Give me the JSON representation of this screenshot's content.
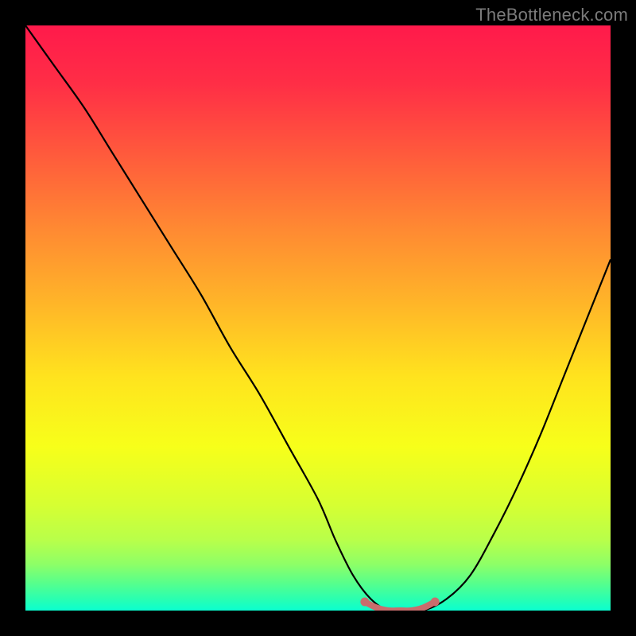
{
  "watermark": "TheBottleneck.com",
  "chart_data": {
    "type": "line",
    "title": "",
    "xlabel": "",
    "ylabel": "",
    "xlim": [
      0,
      100
    ],
    "ylim": [
      0,
      100
    ],
    "legend": false,
    "grid": false,
    "series": [
      {
        "name": "bottleneck-curve",
        "x": [
          0,
          5,
          10,
          15,
          20,
          25,
          30,
          35,
          40,
          45,
          50,
          53,
          56,
          59,
          62,
          65,
          68,
          72,
          76,
          80,
          84,
          88,
          92,
          96,
          100
        ],
        "y": [
          100,
          93,
          86,
          78,
          70,
          62,
          54,
          45,
          37,
          28,
          19,
          12,
          6,
          2,
          0,
          0,
          0,
          2,
          6,
          13,
          21,
          30,
          40,
          50,
          60
        ]
      },
      {
        "name": "optimal-range-marker",
        "x": [
          58,
          60,
          62,
          64,
          66,
          68,
          70
        ],
        "y": [
          1.5,
          0.5,
          0,
          0,
          0,
          0.5,
          1.5
        ]
      }
    ],
    "background_gradient_stops": [
      {
        "offset": 0.0,
        "color": "#ff1a4b"
      },
      {
        "offset": 0.1,
        "color": "#ff2e46"
      },
      {
        "offset": 0.22,
        "color": "#ff5a3c"
      },
      {
        "offset": 0.35,
        "color": "#ff8a32"
      },
      {
        "offset": 0.48,
        "color": "#ffb728"
      },
      {
        "offset": 0.6,
        "color": "#ffe31e"
      },
      {
        "offset": 0.72,
        "color": "#f7ff1a"
      },
      {
        "offset": 0.82,
        "color": "#d6ff32"
      },
      {
        "offset": 0.88,
        "color": "#b8ff4a"
      },
      {
        "offset": 0.92,
        "color": "#8fff66"
      },
      {
        "offset": 0.95,
        "color": "#5cff88"
      },
      {
        "offset": 0.98,
        "color": "#2affb0"
      },
      {
        "offset": 1.0,
        "color": "#0affd0"
      }
    ],
    "colors": {
      "curve": "#000000",
      "marker": "#c96d6d",
      "frame": "#000000"
    }
  }
}
